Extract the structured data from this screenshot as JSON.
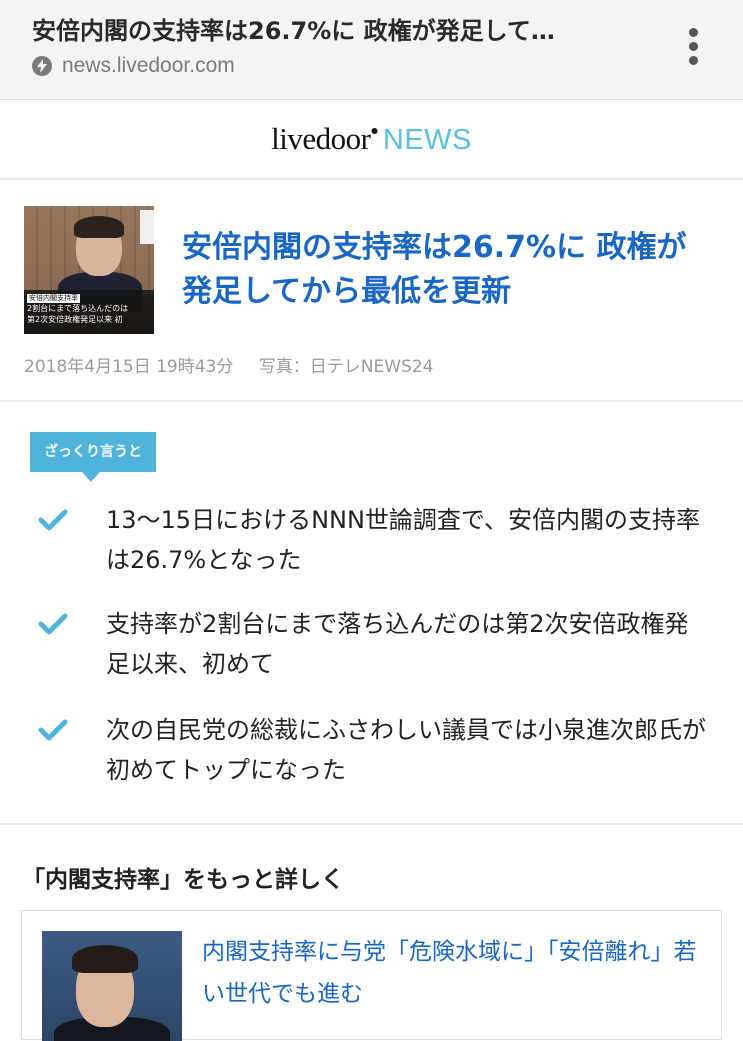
{
  "browser": {
    "page_title": "安倍内閣の支持率は26.7%に 政権が発足して…",
    "domain": "news.livedoor.com"
  },
  "site": {
    "logo_main": "livedoor",
    "logo_dot": "●",
    "logo_news": "NEWS"
  },
  "article": {
    "thumbnail_caption": {
      "tag": "安倍内閣支持率",
      "line1": "2割台にまで落ち込んだのは",
      "line2": "第2次安倍政権発足以来 初"
    },
    "title": "安倍内閣の支持率は26.7%に 政権が発足してから最低を更新",
    "date": "2018年4月15日 19時43分",
    "photo_credit": "写真：日テレNEWS24"
  },
  "summary": {
    "tag": "ざっくり言うと",
    "items": [
      "13〜15日におけるNNN世論調査で、安倍内閣の支持率は26.7%となった",
      "支持率が2割台にまで落ち込んだのは第2次安倍政権発足以来、初めて",
      "次の自民党の総裁にふさわしい議員では小泉進次郎氏が初めてトップになった"
    ]
  },
  "related": {
    "heading": "「内閣支持率」をもっと詳しく",
    "items": [
      {
        "title": "内閣支持率に与党「危険水域に」「安倍離れ」若い世代でも進む"
      }
    ]
  },
  "colors": {
    "accent_blue": "#1a66c4",
    "logo_news": "#5bbfe0",
    "summary_tag": "#4fb3dc",
    "meta_gray": "#9a9a9a"
  },
  "icons": {
    "domain_icon": "bolt-icon",
    "menu_icon": "more-vert-icon",
    "summary_bullet": "check-icon"
  }
}
